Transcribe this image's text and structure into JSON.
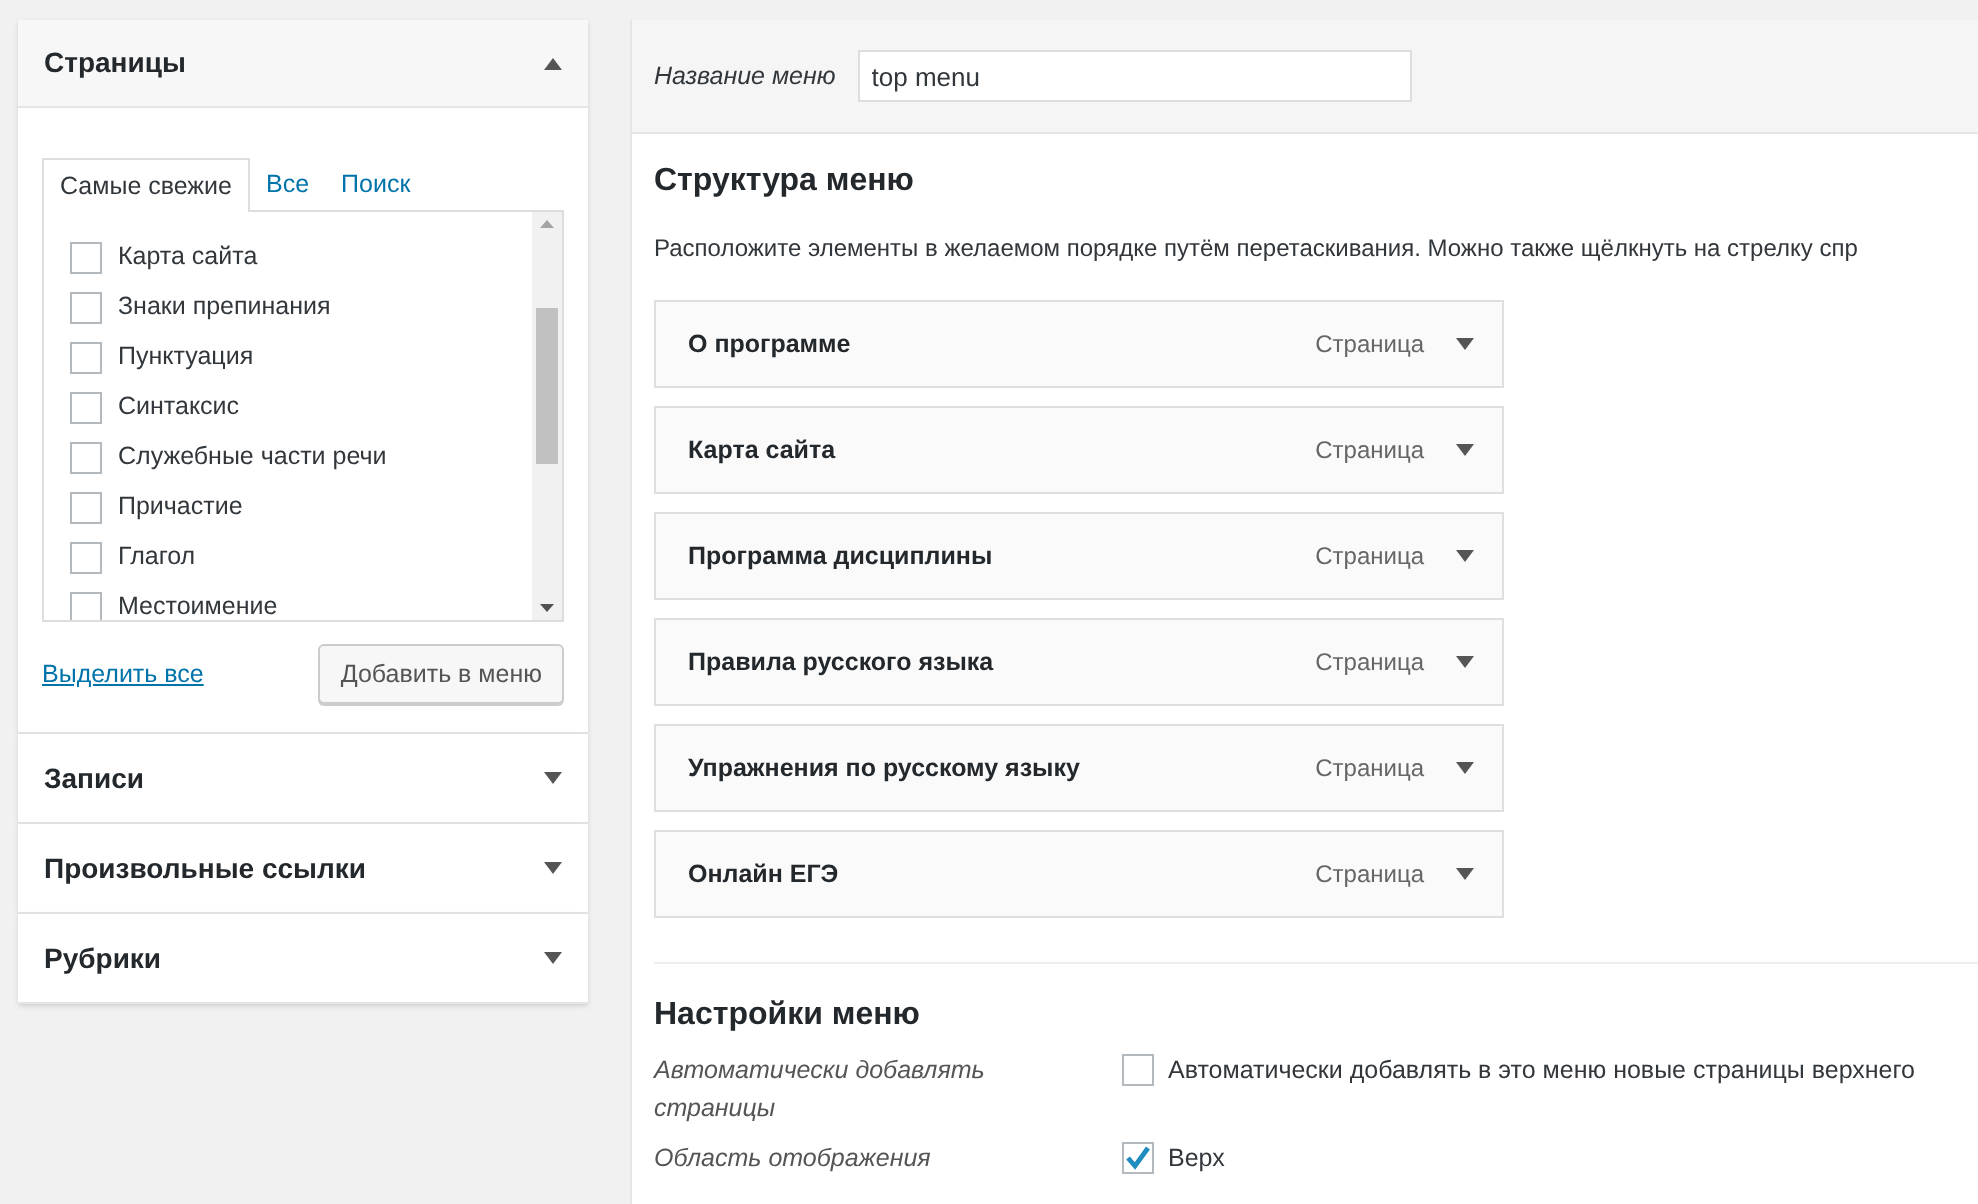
{
  "sidebar": {
    "sections": [
      {
        "title": "Страницы",
        "expanded": true,
        "tabs": [
          {
            "label": "Самые свежие",
            "selected": true
          },
          {
            "label": "Все",
            "selected": false
          },
          {
            "label": "Поиск",
            "selected": false
          }
        ],
        "items": [
          {
            "label": "Карта сайта",
            "checked": false
          },
          {
            "label": "Знаки препинания",
            "checked": false
          },
          {
            "label": "Пунктуация",
            "checked": false
          },
          {
            "label": "Синтаксис",
            "checked": false
          },
          {
            "label": "Служебные части речи",
            "checked": false
          },
          {
            "label": "Причастие",
            "checked": false
          },
          {
            "label": "Глагол",
            "checked": false
          },
          {
            "label": "Местоимение",
            "checked": false
          }
        ],
        "select_all": "Выделить все",
        "add_button": "Добавить в меню"
      },
      {
        "title": "Записи",
        "expanded": false
      },
      {
        "title": "Произвольные ссылки",
        "expanded": false
      },
      {
        "title": "Рубрики",
        "expanded": false
      }
    ]
  },
  "menu_name": {
    "label": "Название меню",
    "value": "top menu"
  },
  "structure": {
    "title": "Структура меню",
    "description": "Расположите элементы в желаемом порядке путём перетаскивания. Можно также щёлкнуть на стрелку спр",
    "items": [
      {
        "title": "О программе",
        "type": "Страница"
      },
      {
        "title": "Карта сайта",
        "type": "Страница"
      },
      {
        "title": "Программа дисциплины",
        "type": "Страница"
      },
      {
        "title": "Правила русского языка",
        "type": "Страница"
      },
      {
        "title": "Упражнения по русскому языку",
        "type": "Страница"
      },
      {
        "title": "Онлайн ЕГЭ",
        "type": "Страница"
      }
    ]
  },
  "settings": {
    "title": "Настройки меню",
    "rows": [
      {
        "label": "Автоматически добавлять страницы",
        "options": [
          {
            "label": "Автоматически добавлять в это меню новые страницы верхнего",
            "checked": false
          }
        ]
      },
      {
        "label": "Область отображения",
        "options": [
          {
            "label": "Верх",
            "checked": true
          }
        ]
      }
    ]
  }
}
